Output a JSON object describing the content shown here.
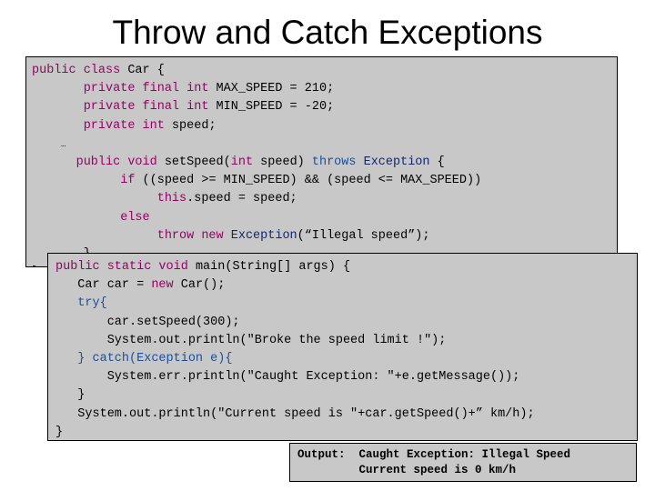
{
  "slide": {
    "title": "Throw and Catch Exceptions"
  },
  "code_panel_class": {
    "name": "car-class-code",
    "background_color": "#c8c8c8",
    "lines": [
      [
        {
          "t": "public class ",
          "c": "kw"
        },
        {
          "t": "Car {",
          "c": "pln"
        }
      ],
      [
        {
          "t": "       private final int ",
          "c": "kw"
        },
        {
          "t": "MAX_SPEED = 210;",
          "c": "pln"
        }
      ],
      [
        {
          "t": "       private final int ",
          "c": "kw"
        },
        {
          "t": "MIN_SPEED = -20;",
          "c": "pln"
        }
      ],
      [
        {
          "t": "       private int ",
          "c": "kw"
        },
        {
          "t": "speed;",
          "c": "pln"
        }
      ],
      [
        {
          "t": "     …",
          "c": "ellipsis"
        }
      ],
      [
        {
          "t": "      public void ",
          "c": "kw"
        },
        {
          "t": "setSpeed(",
          "c": "pln"
        },
        {
          "t": "int",
          "c": "kw"
        },
        {
          "t": " speed) ",
          "c": "pln"
        },
        {
          "t": "throws ",
          "c": "kw2"
        },
        {
          "t": "Exception",
          "c": "type"
        },
        {
          "t": " {",
          "c": "pln"
        }
      ],
      [
        {
          "t": "            if ",
          "c": "kw"
        },
        {
          "t": "((speed >= MIN_SPEED) && (speed <= MAX_SPEED))",
          "c": "pln"
        }
      ],
      [
        {
          "t": "                 this",
          "c": "kw"
        },
        {
          "t": ".speed = speed;",
          "c": "pln"
        }
      ],
      [
        {
          "t": "            else",
          "c": "kw"
        }
      ],
      [
        {
          "t": "                 throw new ",
          "c": "kw"
        },
        {
          "t": "Exception",
          "c": "type"
        },
        {
          "t": "(“Illegal speed”);",
          "c": "pln"
        }
      ],
      [
        {
          "t": "       }",
          "c": "pln"
        }
      ],
      [
        {
          "t": "}",
          "c": "pln"
        }
      ]
    ]
  },
  "code_panel_main": {
    "name": "main-method-code",
    "background_color": "#c8c8c8",
    "lines": [
      [
        {
          "t": "public static void ",
          "c": "kw"
        },
        {
          "t": "main(String[] args) {",
          "c": "pln"
        }
      ],
      [
        {
          "t": "   Car car = ",
          "c": "pln"
        },
        {
          "t": "new",
          "c": "kw"
        },
        {
          "t": " Car();",
          "c": "pln"
        }
      ],
      [
        {
          "t": "   try{",
          "c": "kw2"
        }
      ],
      [
        {
          "t": "       car.setSpeed(300);",
          "c": "pln"
        }
      ],
      [
        {
          "t": "       System.out.println(\"Broke the speed limit !\");",
          "c": "pln"
        }
      ],
      [
        {
          "t": "   } catch(Exception e){",
          "c": "kw2"
        }
      ],
      [
        {
          "t": "       System.err.println(\"Caught Exception: \"+e.getMessage());",
          "c": "pln"
        }
      ],
      [
        {
          "t": "   }",
          "c": "pln"
        }
      ],
      [
        {
          "t": "   System.out.println(\"Current speed is \"+car.getSpeed()+” km/h);",
          "c": "pln"
        }
      ],
      [
        {
          "t": "}",
          "c": "pln"
        }
      ]
    ]
  },
  "output_box": {
    "name": "program-output",
    "background_color": "#c8c8c8",
    "lines": [
      "Output:  Caught Exception: Illegal Speed",
      "         Current speed is 0 km/h"
    ]
  }
}
